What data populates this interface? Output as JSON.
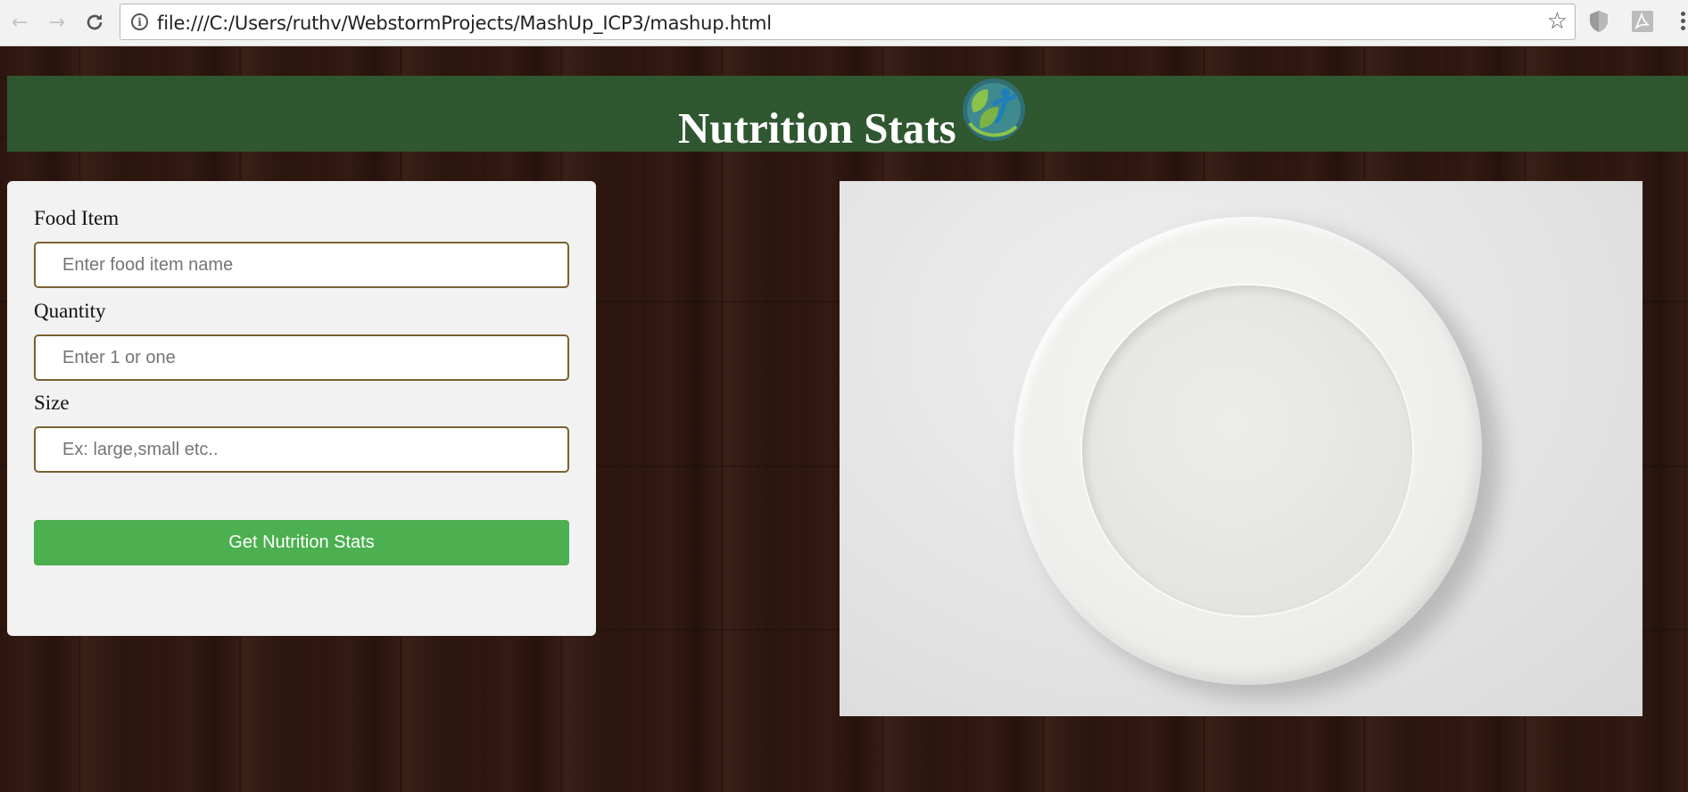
{
  "browser": {
    "url": "file:///C:/Users/ruthv/WebstormProjects/MashUp_ICP3/mashup.html",
    "icons": {
      "back": "back-arrow-icon",
      "forward": "forward-arrow-icon",
      "reload": "reload-icon",
      "info": "info-icon",
      "star": "star-icon",
      "shield_extension": "shield-icon",
      "pdf_extension": "pdf-icon",
      "menu": "more-vertical-icon"
    }
  },
  "header": {
    "title": "Nutrition Stats",
    "background_color": "#2f5730",
    "logo": "leaf-person-logo"
  },
  "form": {
    "food_item": {
      "label": "Food Item",
      "placeholder": "Enter food item name",
      "value": ""
    },
    "quantity": {
      "label": "Quantity",
      "placeholder": "Enter 1 or one",
      "value": ""
    },
    "size": {
      "label": "Size",
      "placeholder": "Ex: large,small etc..",
      "value": ""
    },
    "submit_label": "Get Nutrition Stats",
    "submit_color": "#4caf50",
    "border_color": "#7a6230"
  },
  "main_image": {
    "subject": "empty-white-plate"
  }
}
